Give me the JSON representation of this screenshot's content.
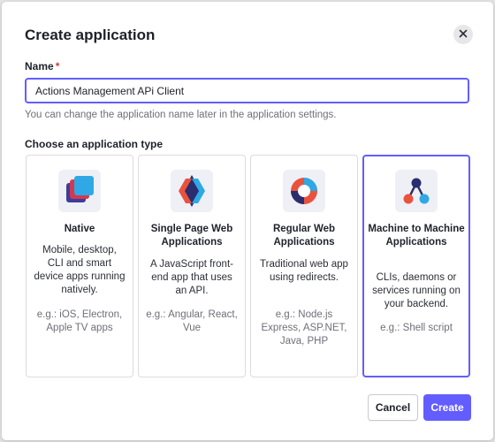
{
  "dialog": {
    "title": "Create application",
    "close_icon": "close-icon"
  },
  "name_field": {
    "label": "Name",
    "required_marker": "*",
    "value": "Actions Management APi Client",
    "hint": "You can change the application name later in the application settings."
  },
  "app_types": {
    "label": "Choose an application type",
    "selected": "Machine to Machine Applications",
    "cards": [
      {
        "icon": "native-app-icon",
        "title": "Native",
        "description": "Mobile, desktop, CLI and smart device apps running natively.",
        "examples": "e.g.: iOS, Electron, Apple TV apps"
      },
      {
        "icon": "spa-icon",
        "title": "Single Page Web Applications",
        "description": "A JavaScript front-end app that uses an API.",
        "examples": "e.g.: Angular, React, Vue"
      },
      {
        "icon": "regular-web-app-icon",
        "title": "Regular Web Applications",
        "description": "Traditional web app using redirects.",
        "examples": "e.g.: Node.js Express, ASP.NET, Java, PHP"
      },
      {
        "icon": "machine-to-machine-icon",
        "title": "Machine to Machine Applications",
        "description": "CLIs, daemons or services running on your backend.",
        "examples": "e.g.: Shell script"
      }
    ]
  },
  "footer": {
    "cancel_label": "Cancel",
    "create_label": "Create"
  },
  "colors": {
    "accent": "#635dff",
    "required": "#d03c38",
    "muted_text": "#6f6f78"
  }
}
